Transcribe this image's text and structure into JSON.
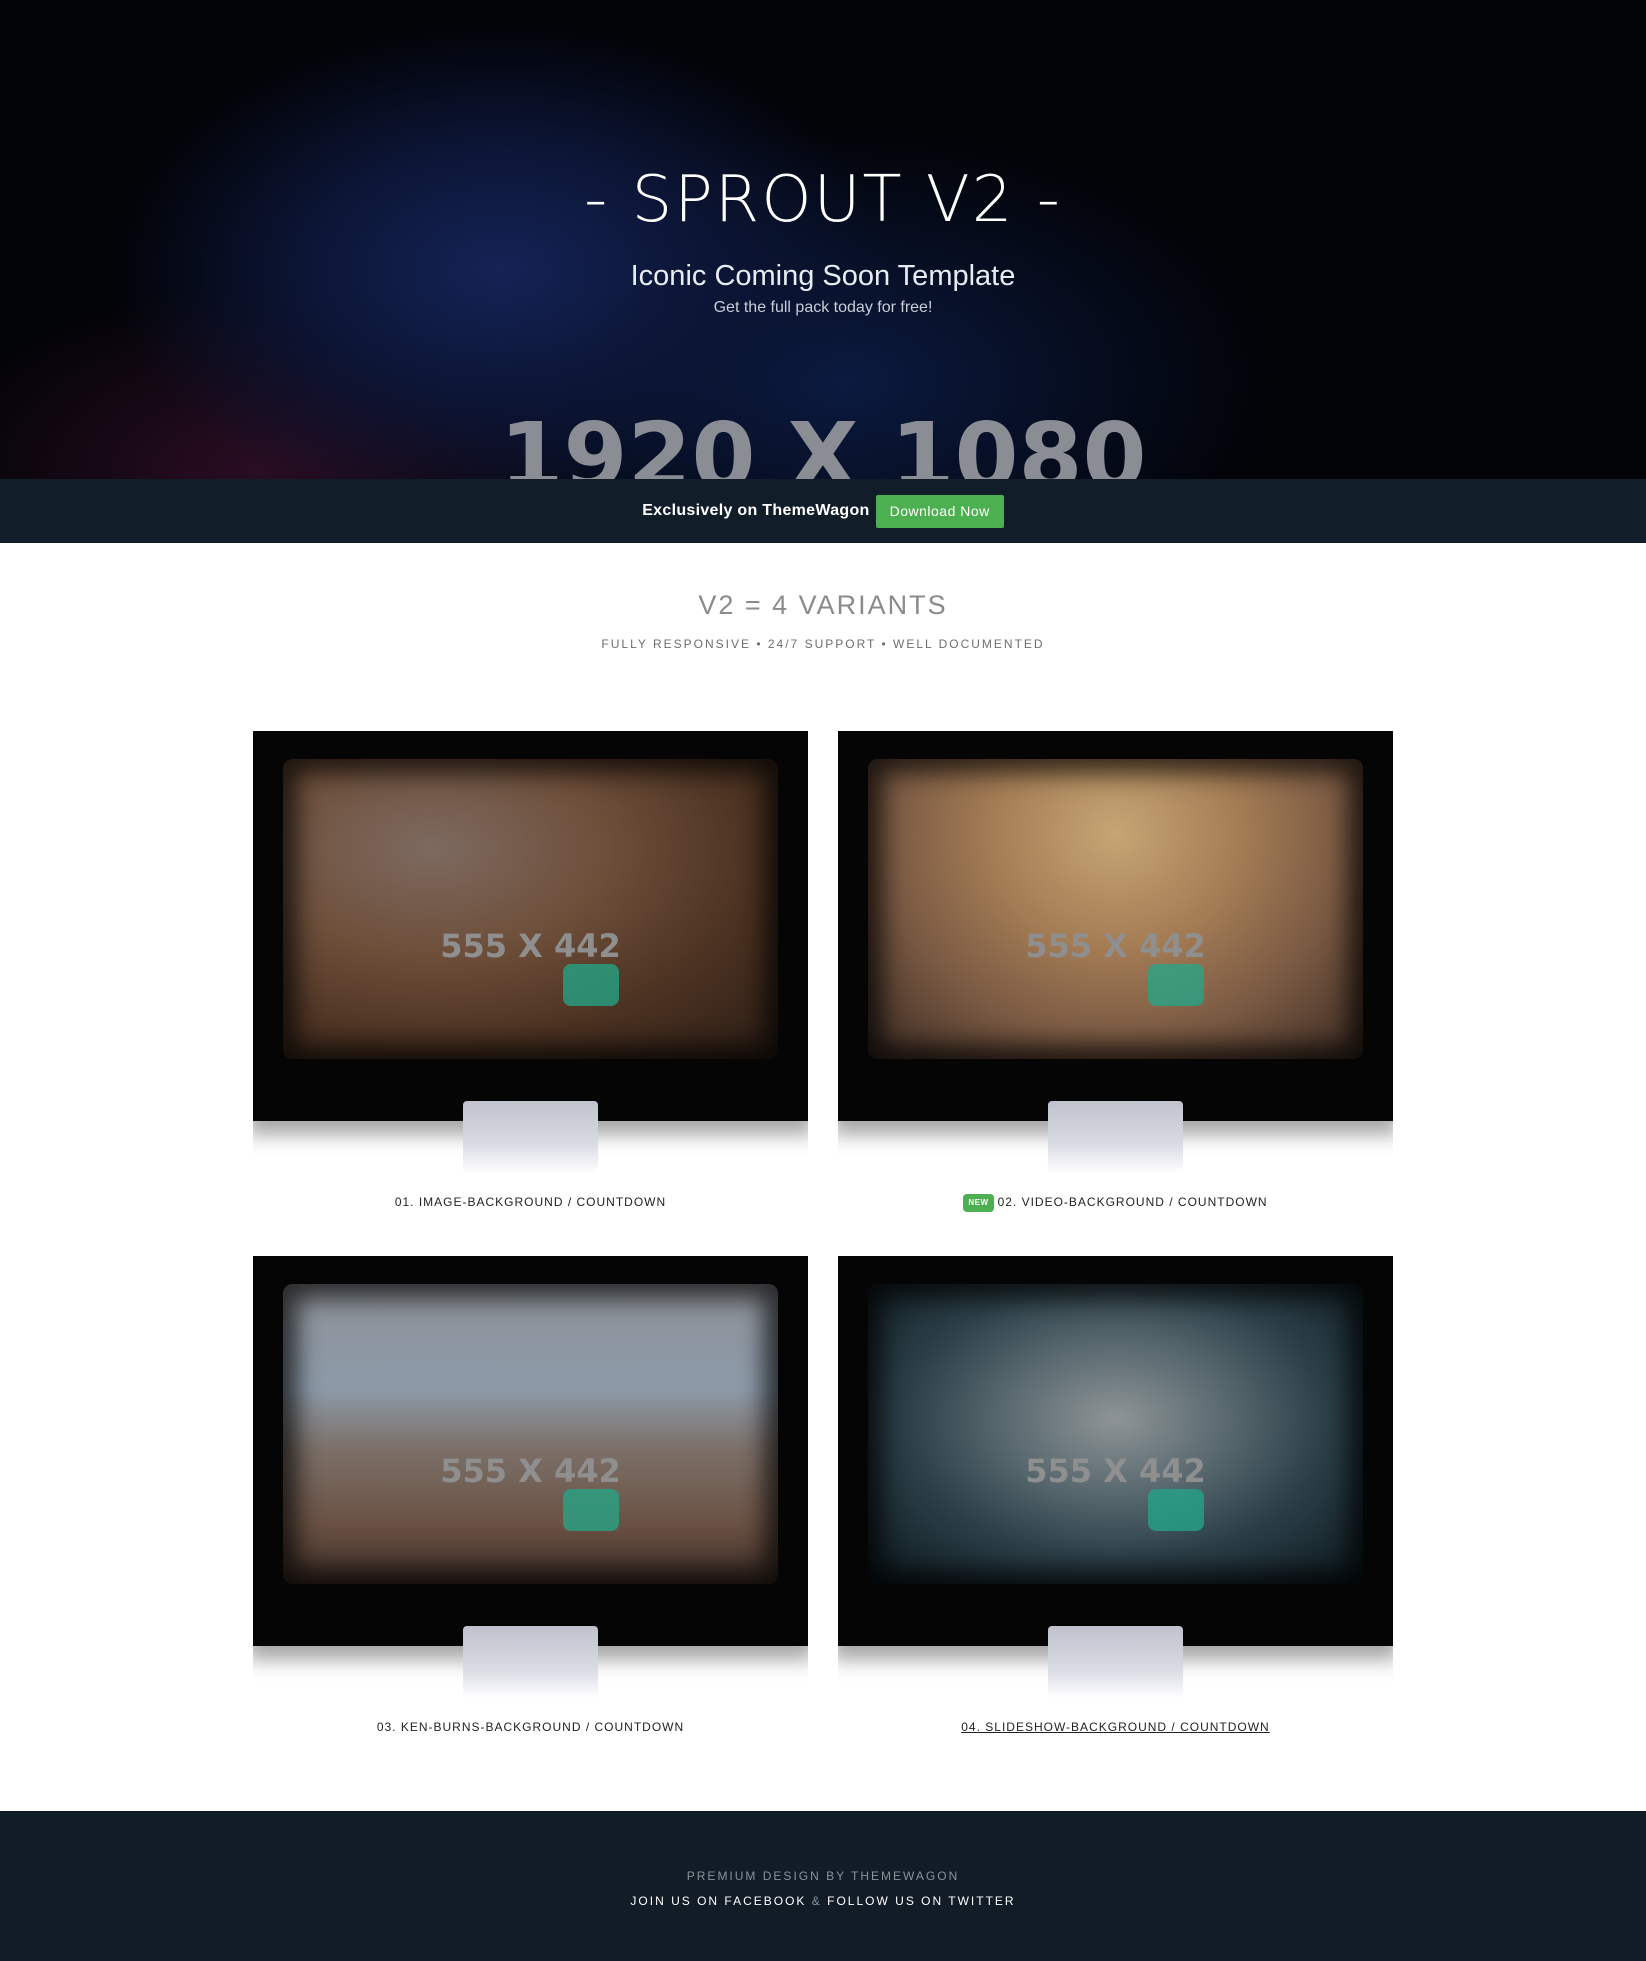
{
  "hero": {
    "title": "- SPROUT V2 -",
    "subtitle": "Iconic Coming Soon Template",
    "tagline": "Get the full pack today for free!",
    "image_placeholder": "1920 X 1080"
  },
  "banner": {
    "text": "Exclusively on ThemeWagon",
    "download_label": "Download Now",
    "download_color": "#4caf50"
  },
  "variants": {
    "title": "V2 = 4 VARIANTS",
    "subtitle": "FULLY RESPONSIVE • 24/7 SUPPORT • WELL DOCUMENTED",
    "items": [
      {
        "placeholder": "555 X 442",
        "label": "01. IMAGE-BACKGROUND / COUNTDOWN",
        "badge": ""
      },
      {
        "placeholder": "555 X 442",
        "label": "02. VIDEO-BACKGROUND / COUNTDOWN",
        "badge": "NEW"
      },
      {
        "placeholder": "555 X 442",
        "label": "03. KEN-BURNS-BACKGROUND / COUNTDOWN",
        "badge": ""
      },
      {
        "placeholder": "555 X 442",
        "label": "04. SLIDESHOW-BACKGROUND / COUNTDOWN",
        "badge": ""
      }
    ]
  },
  "footer": {
    "credit": "PREMIUM DESIGN BY THEMEWAGON",
    "facebook": "JOIN US ON FACEBOOK",
    "separator": "&",
    "twitter": "FOLLOW US ON TWITTER"
  }
}
